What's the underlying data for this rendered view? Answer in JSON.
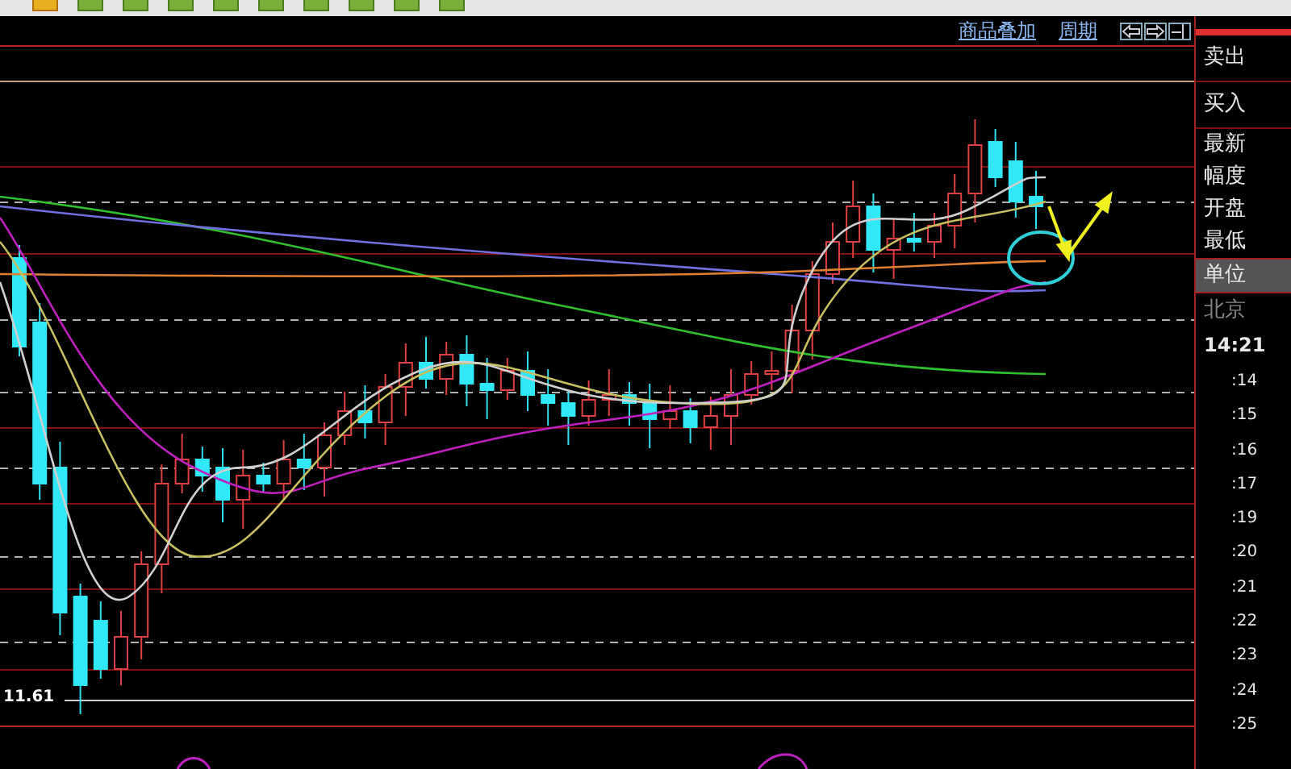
{
  "chart_header": {
    "links": [
      {
        "label": "商品叠加"
      },
      {
        "label": "周期"
      }
    ]
  },
  "chart": {
    "low_price_label": "11.61"
  },
  "side_panel": {
    "items": [
      {
        "kind": "action",
        "label": "卖出",
        "selected": false
      },
      {
        "kind": "action",
        "label": "买入",
        "selected": false
      },
      {
        "kind": "field",
        "label": "最新",
        "selected": false
      },
      {
        "kind": "field",
        "label": "幅度",
        "selected": false
      },
      {
        "kind": "field",
        "label": "开盘",
        "selected": false
      },
      {
        "kind": "field",
        "label": "最低",
        "selected": false
      },
      {
        "kind": "field",
        "label": "单位",
        "selected": true
      },
      {
        "kind": "zone",
        "label": "北京",
        "selected": false
      },
      {
        "kind": "time",
        "label": "14:21",
        "selected": false
      },
      {
        "kind": "tick",
        "label": ":14",
        "selected": false
      },
      {
        "kind": "tick",
        "label": ":15",
        "selected": false
      },
      {
        "kind": "tick",
        "label": ":16",
        "selected": false
      },
      {
        "kind": "tick",
        "label": ":17",
        "selected": false
      },
      {
        "kind": "tick",
        "label": ":19",
        "selected": false
      },
      {
        "kind": "tick",
        "label": ":20",
        "selected": false
      },
      {
        "kind": "tick",
        "label": ":21",
        "selected": false
      },
      {
        "kind": "tick",
        "label": ":22",
        "selected": false
      },
      {
        "kind": "tick",
        "label": ":23",
        "selected": false
      },
      {
        "kind": "tick",
        "label": ":24",
        "selected": false
      },
      {
        "kind": "tick",
        "label": ":25",
        "selected": false
      }
    ]
  }
}
